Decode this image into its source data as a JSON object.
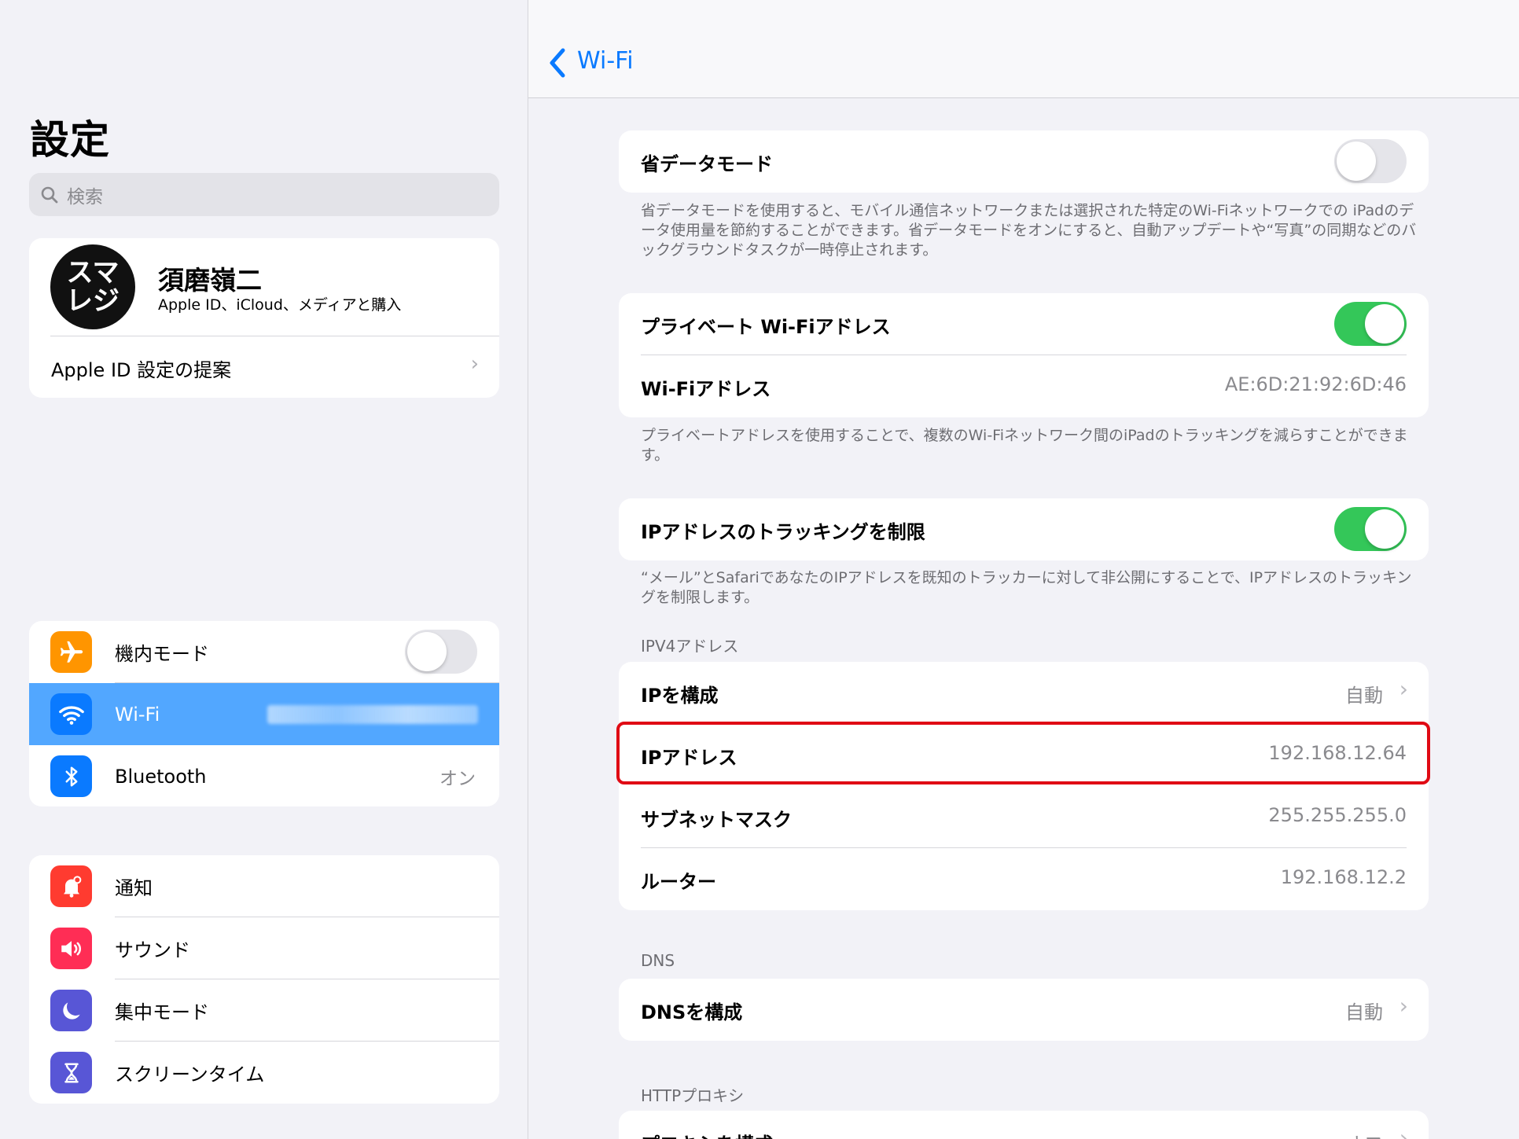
{
  "sidebar": {
    "title": "設定",
    "search_placeholder": "検索",
    "profile": {
      "avatar_line1": "スマ",
      "avatar_line2": "レジ",
      "name": "須磨嶺二",
      "subtitle": "Apple ID、iCloud、メディアと購入",
      "suggest_label": "Apple ID 設定の提案"
    },
    "connectivity": [
      {
        "label": "機内モード",
        "icon": "airplane-icon",
        "color": "#ff9500",
        "toggle": "off"
      },
      {
        "label": "Wi-Fi",
        "icon": "wifi-icon",
        "color": "#0a7aff",
        "selected": true
      },
      {
        "label": "Bluetooth",
        "icon": "bluetooth-icon",
        "color": "#0a7aff",
        "value": "オン"
      }
    ],
    "general": [
      {
        "label": "通知",
        "icon": "bell-icon",
        "color": "#ff3b30"
      },
      {
        "label": "サウンド",
        "icon": "speaker-icon",
        "color": "#ff2d55"
      },
      {
        "label": "集中モード",
        "icon": "moon-icon",
        "color": "#5856d6"
      },
      {
        "label": "スクリーンタイム",
        "icon": "hourglass-icon",
        "color": "#5856d6"
      }
    ]
  },
  "detail": {
    "nav_back_label": "Wi-Fi",
    "low_data_mode": {
      "label": "省データモード",
      "toggle": "off",
      "footnote": "省データモードを使用すると、モバイル通信ネットワークまたは選択された特定のWi-Fiネットワークでの iPadのデータ使用量を節約することができます。省データモードをオンにすると、自動アップデートや“写真”の同期などのバックグラウンドタスクが一時停止されます。"
    },
    "private_address": {
      "label": "プライベート Wi-Fiアドレス",
      "toggle": "on",
      "wifi_address_label": "Wi-Fiアドレス",
      "wifi_address_value": "AE:6D:21:92:6D:46",
      "footnote": "プライベートアドレスを使用することで、複数のWi-Fiネットワーク間のiPadのトラッキングを減らすことができます。"
    },
    "ip_tracking": {
      "label": "IPアドレスのトラッキングを制限",
      "toggle": "on",
      "footnote": "“メール”とSafariであなたのIPアドレスを既知のトラッカーに対して非公開にすることで、IPアドレスのトラッキングを制限します。"
    },
    "ipv4": {
      "header": "IPV4アドレス",
      "configure_label": "IPを構成",
      "configure_value": "自動",
      "ip_label": "IPアドレス",
      "ip_value": "192.168.12.64",
      "subnet_label": "サブネットマスク",
      "subnet_value": "255.255.255.0",
      "router_label": "ルーター",
      "router_value": "192.168.12.2"
    },
    "dns": {
      "header": "DNS",
      "configure_label": "DNSを構成",
      "configure_value": "自動"
    },
    "http_proxy": {
      "header": "HTTPプロキシ",
      "configure_label": "プロキシを構成",
      "configure_value": "オフ"
    }
  },
  "colors": {
    "accent": "#0a7aff",
    "toggle_on": "#34c759",
    "highlight": "#e00a14",
    "selected_row": "#52a7ff"
  }
}
